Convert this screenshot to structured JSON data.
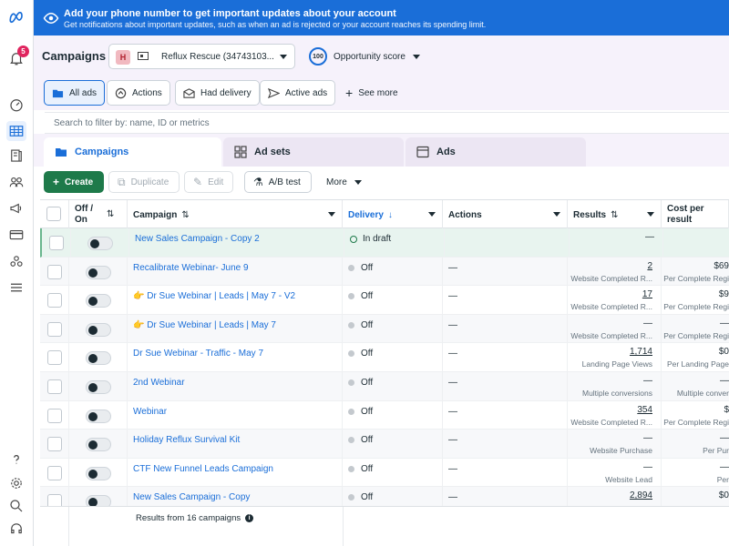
{
  "banner": {
    "title": "Add your phone number to get important updates about your account",
    "subtitle": "Get notifications about important updates, such as when an ad is rejected or your account reaches its spending limit."
  },
  "rail": {
    "notification_count": "5"
  },
  "header": {
    "title": "Campaigns",
    "account_initial": "H",
    "account_name": "Reflux Rescue (34743103...",
    "opportunity_score": "100",
    "opportunity_label": "Opportunity score"
  },
  "filters": {
    "all_ads": "All ads",
    "actions": "Actions",
    "had_delivery": "Had delivery",
    "active_ads": "Active ads",
    "see_more": "See more"
  },
  "search": {
    "placeholder": "Search to filter by: name, ID or metrics"
  },
  "tabs": {
    "campaigns": "Campaigns",
    "ad_sets": "Ad sets",
    "ads": "Ads"
  },
  "toolbar": {
    "create": "Create",
    "duplicate": "Duplicate",
    "edit": "Edit",
    "ab_test": "A/B test",
    "more": "More"
  },
  "columns": {
    "off_on": "Off / On",
    "campaign": "Campaign",
    "delivery": "Delivery",
    "actions": "Actions",
    "results": "Results",
    "cost_per_result": "Cost per result"
  },
  "rows": [
    {
      "name": "New Sales Campaign - Copy 2",
      "delivery": "In draft",
      "actions": "",
      "result": "—",
      "result_sub": "",
      "cost": "",
      "cost_sub": ""
    },
    {
      "name": "Recalibrate Webinar- June 9",
      "delivery": "Off",
      "actions": "—",
      "result": "2",
      "result_sub": "Website Completed R...",
      "cost": "$69",
      "cost_sub": "Per Complete Regi"
    },
    {
      "name": "👉 Dr Sue Webinar | Leads | May 7 - V2",
      "delivery": "Off",
      "actions": "—",
      "result": "17",
      "result_sub": "Website Completed R...",
      "cost": "$9",
      "cost_sub": "Per Complete Regi"
    },
    {
      "name": "👉 Dr Sue Webinar | Leads | May 7",
      "delivery": "Off",
      "actions": "—",
      "result": "—",
      "result_sub": "Website Completed R...",
      "cost": "—",
      "cost_sub": "Per Complete Regi"
    },
    {
      "name": "Dr Sue Webinar - Traffic - May 7",
      "delivery": "Off",
      "actions": "—",
      "result": "1,714",
      "result_sub": "Landing Page Views",
      "cost": "$0",
      "cost_sub": "Per Landing Page"
    },
    {
      "name": "2nd Webinar",
      "delivery": "Off",
      "actions": "—",
      "result": "—",
      "result_sub": "Multiple conversions",
      "cost": "—",
      "cost_sub": "Multiple conver"
    },
    {
      "name": "Webinar",
      "delivery": "Off",
      "actions": "—",
      "result": "354",
      "result_sub": "Website Completed R...",
      "cost": "$",
      "cost_sub": "Per Complete Regi"
    },
    {
      "name": "Holiday Reflux Survival Kit",
      "delivery": "Off",
      "actions": "—",
      "result": "—",
      "result_sub": "Website Purchase",
      "cost": "—",
      "cost_sub": "Per Pur"
    },
    {
      "name": "CTF New Funnel Leads Campaign",
      "delivery": "Off",
      "actions": "—",
      "result": "—",
      "result_sub": "Website Lead",
      "cost": "—",
      "cost_sub": "Per"
    },
    {
      "name": "New Sales Campaign - Copy",
      "delivery": "Off",
      "actions": "—",
      "result": "2,894",
      "result_sub": "",
      "cost": "$0",
      "cost_sub": ""
    }
  ],
  "footer": {
    "summary": "Results from 16 campaigns"
  }
}
